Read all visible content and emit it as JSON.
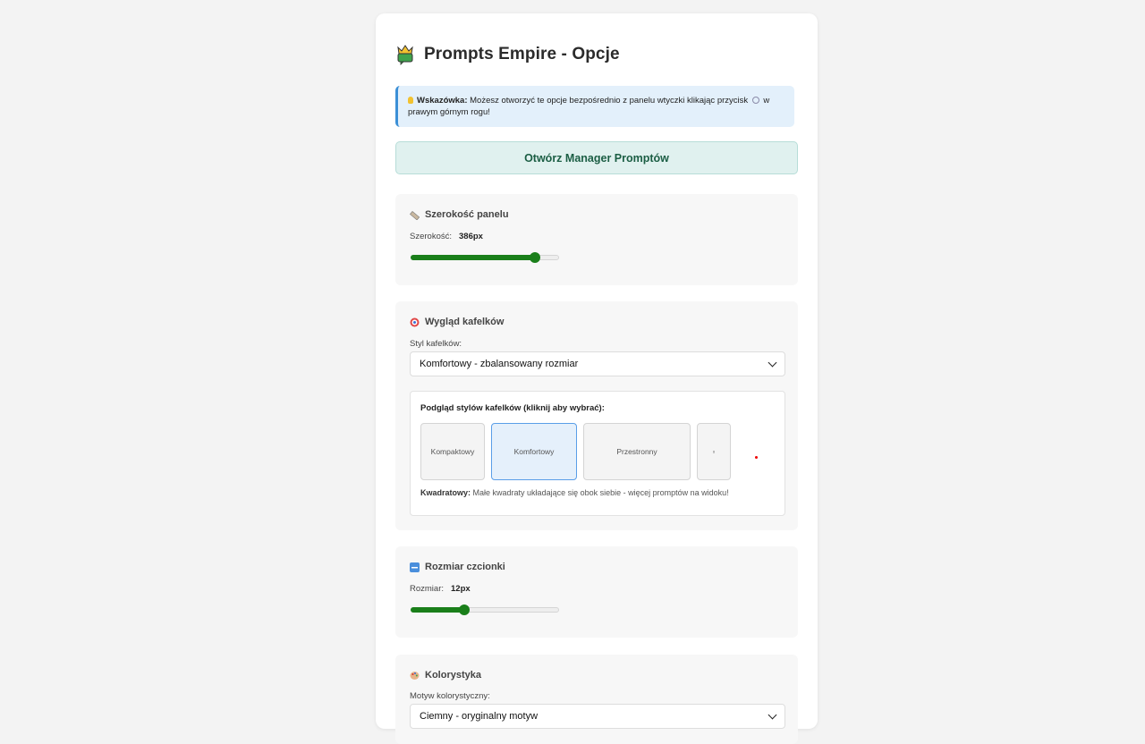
{
  "page": {
    "title": "Prompts Empire - Opcje"
  },
  "tip": {
    "label": "Wskazówka:",
    "text_before": "Możesz otworzyć te opcje bezpośrednio z panelu wtyczki klikając przycisk",
    "text_after": "w prawym górnym rogu!"
  },
  "manager_button": {
    "label": "Otwórz Manager Promptów"
  },
  "panel_width": {
    "title": "Szerokość panelu",
    "label": "Szerokość:",
    "value": "386px",
    "slider_fraction": 0.84
  },
  "tiles_section": {
    "title": "Wygląd kafelków",
    "style_label": "Styl kafelków:",
    "style_selected": "Komfortowy - zbalansowany rozmiar",
    "preview_title": "Podgląd stylów kafelków (kliknij aby wybrać):",
    "tiles": [
      {
        "label": "Kompaktowy",
        "active": false
      },
      {
        "label": "Komfortowy",
        "active": true
      },
      {
        "label": "Przestronny",
        "active": false
      },
      {
        "label": "▫",
        "active": false
      }
    ],
    "desc_label": "Kwadratowy:",
    "desc_text": "Małe kwadraty układające się obok siebie - więcej promptów na widoku!"
  },
  "font_size": {
    "title": "Rozmiar czcionki",
    "label": "Rozmiar:",
    "value": "12px",
    "slider_fraction": 0.36
  },
  "colors": {
    "title": "Kolorystyka",
    "theme_label": "Motyw kolorystyczny:",
    "theme_selected": "Ciemny - oryginalny motyw"
  },
  "palette": {
    "accent": "#1a7f1a",
    "tip_border": "#3b8fd6",
    "button_bg": "#e0f1ef"
  },
  "icons": [
    "crown-icon",
    "bulb-icon",
    "gear-icon",
    "ruler-icon",
    "target-icon",
    "abc-icon",
    "palette-icon",
    "chevron-down-icon"
  ]
}
